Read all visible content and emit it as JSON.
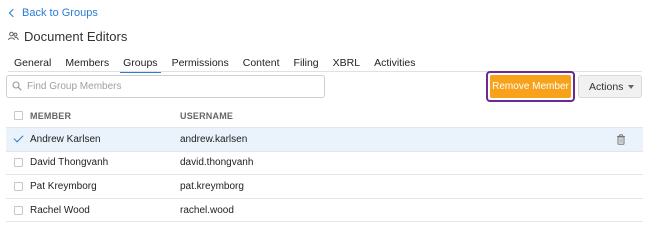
{
  "back_link": "Back to Groups",
  "page_title": "Document Editors",
  "tabs": [
    {
      "label": "General",
      "active": false
    },
    {
      "label": "Members",
      "active": false
    },
    {
      "label": "Groups",
      "active": true
    },
    {
      "label": "Permissions",
      "active": false
    },
    {
      "label": "Content",
      "active": false
    },
    {
      "label": "Filing",
      "active": false
    },
    {
      "label": "XBRL",
      "active": false
    },
    {
      "label": "Activities",
      "active": false
    }
  ],
  "search": {
    "placeholder": "Find Group Members",
    "value": ""
  },
  "toolbar": {
    "remove_member_label": "Remove Member",
    "actions_label": "Actions"
  },
  "table": {
    "headers": {
      "member": "MEMBER",
      "username": "USERNAME"
    },
    "rows": [
      {
        "member": "Andrew Karlsen",
        "username": "andrew.karlsen",
        "selected": true
      },
      {
        "member": "David Thongvanh",
        "username": "david.thongvanh",
        "selected": false
      },
      {
        "member": "Pat Kreymborg",
        "username": "pat.kreymborg",
        "selected": false
      },
      {
        "member": "Rachel Wood",
        "username": "rachel.wood",
        "selected": false
      }
    ]
  },
  "colors": {
    "accent": "#2a7bd5",
    "remove_button": "#f7a21a",
    "highlight_outline": "#6b2a8f",
    "selected_row": "#eaf3fb"
  },
  "icons": {
    "back": "chevron-left-icon",
    "group": "group-icon",
    "search": "search-icon",
    "actions": "caret-down-icon",
    "delete": "trash-icon",
    "selected": "checkmark-icon"
  }
}
